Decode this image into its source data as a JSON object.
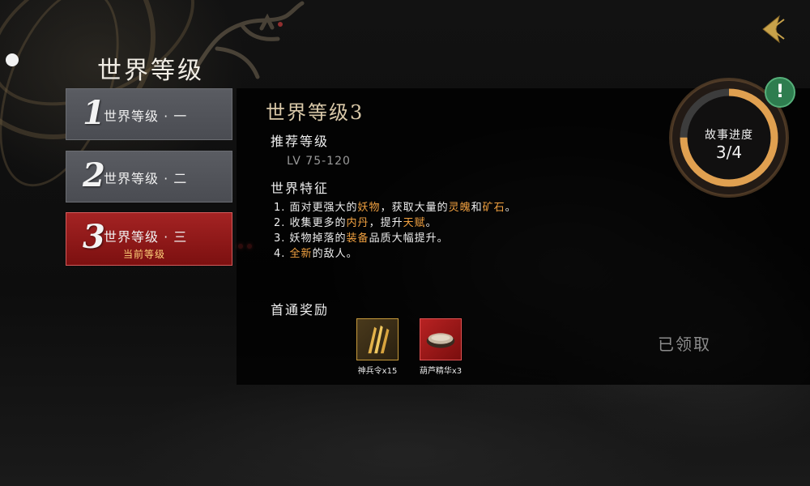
{
  "page": {
    "title": "世界等级"
  },
  "levels": [
    {
      "num": "1",
      "label": "世界等级 · 一",
      "sub": "",
      "active": false
    },
    {
      "num": "2",
      "label": "世界等级 · 二",
      "sub": "",
      "active": false
    },
    {
      "num": "3",
      "label": "世界等级 · 三",
      "sub": "当前等级",
      "active": true
    }
  ],
  "detail": {
    "title": "世界等级3",
    "recommend_label": "推荐等级",
    "recommend_value": "LV 75-120",
    "features_label": "世界特征",
    "features": [
      {
        "pre": "1. 面对更强大的",
        "h1": "妖物",
        "mid": "，获取大量的",
        "h2": "灵魄",
        "mid2": "和",
        "h3": "矿石",
        "post": "。"
      },
      {
        "pre": "2. 收集更多的",
        "h1": "内丹",
        "mid": "，提升",
        "h2": "天赋",
        "mid2": "",
        "h3": "",
        "post": "。"
      },
      {
        "pre": "3. 妖物掉落的",
        "h1": "装备",
        "mid": "品质大幅提升。",
        "h2": "",
        "mid2": "",
        "h3": "",
        "post": ""
      },
      {
        "pre": "4. ",
        "h1": "全新",
        "mid": "的敌人。",
        "h2": "",
        "mid2": "",
        "h3": "",
        "post": ""
      }
    ],
    "reward_label": "首通奖励",
    "rewards": [
      {
        "name": "神兵令x15",
        "icon": "weapon-token-icon"
      },
      {
        "name": "葫芦精华x3",
        "icon": "gourd-essence-icon"
      }
    ],
    "claimed_label": "已领取"
  },
  "progress": {
    "title": "故事进度",
    "value": "3/4",
    "fraction": 0.75
  },
  "colors": {
    "highlight": "#f0a040",
    "active_level": "#a42323",
    "progress_ring": "#e0a050",
    "alert": "#2e7d4f"
  }
}
